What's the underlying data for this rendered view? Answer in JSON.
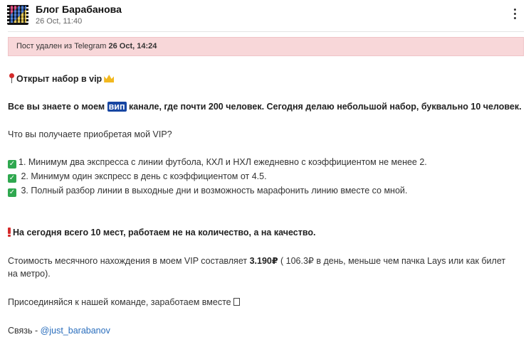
{
  "header": {
    "channel_name": "Блог Барабанова",
    "post_time": "26 Oct, 11:40",
    "menu_icon": "more-vertical-icon"
  },
  "notice": {
    "prefix": "Пост удален из Telegram ",
    "date": "26 Oct, 14:24"
  },
  "post": {
    "headline": "Открыт набор в vip",
    "intro_before": "Все вы знаете о моем ",
    "intro_highlight": "вип",
    "intro_after": " канале, где почти 200 человек. Сегодня делаю небольшой набор, буквально 10 человек.",
    "question": "Что вы получаете приобретая мой VIP?",
    "benefits": [
      "1. Минимум два экспресса с линии футбола, КХЛ и НХЛ ежедневно с коэффициентом не менее 2.",
      " 2. Минимум один экспресс в день с коэффициентом от 4.5.",
      " 3. Полный разбор линии в выходные дни и возможность марафонить линию вместе со мной."
    ],
    "limit": "На сегодня всего 10 мест, работаем не на количество, а на качество.",
    "price_before": "Стоимость месячного нахождения в моем VIP составляет ",
    "price_value": "3.190₽",
    "price_after": " ( 106.3₽ в день, меньше чем пачка Lays или как билет",
    "price_line2": "на метро).",
    "join": "Присоединяйся к нашей команде, заработаем вместе",
    "contact_label": "Связь - ",
    "contact_handle": "@just_barabanov"
  },
  "icons": {
    "pin": "pushpin-icon",
    "crown": "crown-icon",
    "check": "check-mark-icon",
    "exclamation": "exclamation-icon",
    "unknown_glyph": "missing-glyph-icon"
  },
  "colors": {
    "notice_bg": "#f8d7d9",
    "highlight_bg": "#1746a2",
    "check_green": "#2fa84f",
    "link": "#2a6ebd"
  }
}
